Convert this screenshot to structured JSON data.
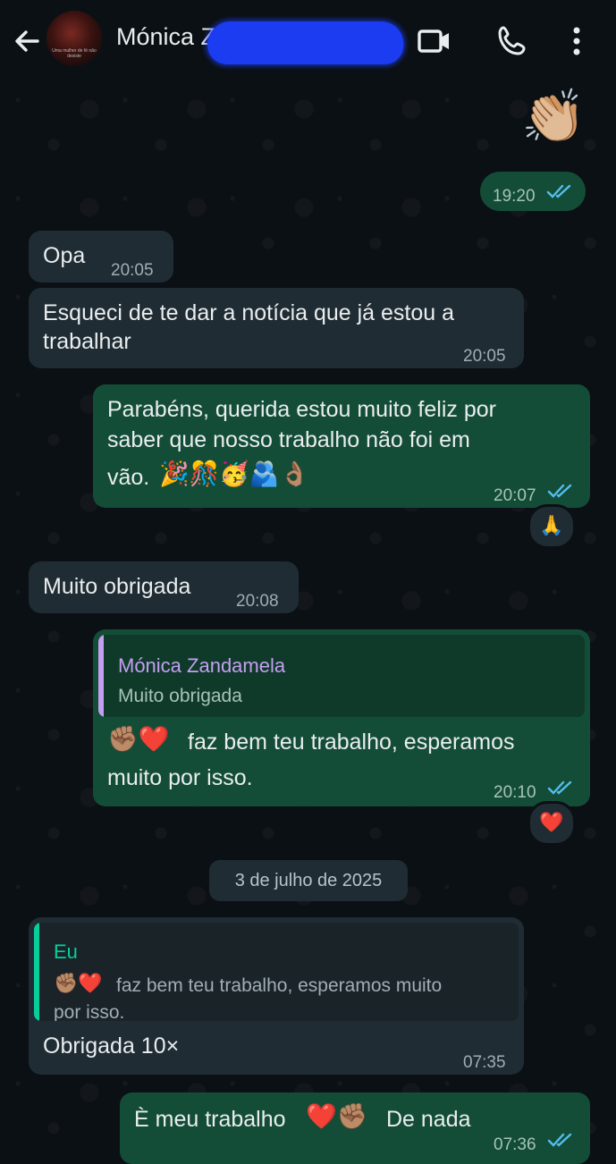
{
  "header": {
    "contact_name": "Mónica Z",
    "avatar_caption": "Uma mulher de fé não desiste"
  },
  "colors": {
    "incoming": "#1f2c33",
    "outgoing": "#144d37",
    "read_ticks": "#53bdeb",
    "reply_accent_other": "#c49ff0",
    "reply_accent_me": "#06cf9c"
  },
  "messages": [
    {
      "id": "m1",
      "sticker": "👏🏼",
      "time": "19:20",
      "status": "read"
    },
    {
      "id": "m2",
      "text": "Opa",
      "time": "20:05"
    },
    {
      "id": "m3",
      "line1": "Esqueci de te dar a notícia que já estou a",
      "line2": "trabalhar",
      "time": "20:05"
    },
    {
      "id": "m4",
      "line1": "Parabéns, querida estou muito feliz por",
      "line2": "saber que nosso trabalho não foi em",
      "line3": "vão.",
      "emojis": "🎉🎊🥳🫂👌🏽",
      "time": "20:07",
      "status": "read",
      "reaction": "🙏"
    },
    {
      "id": "m5",
      "text": "Muito obrigada",
      "time": "20:08"
    },
    {
      "id": "m6",
      "reply_author": "Mónica Zandamela",
      "reply_text": "Muito obrigada",
      "emojis": "✊🏽❤️",
      "line1": "faz bem teu trabalho, esperamos",
      "line2": "muito por isso.",
      "time": "20:10",
      "status": "read",
      "reaction": "❤️"
    },
    {
      "id": "m7",
      "reply_author": "Eu",
      "reply_emojis": "✊🏽❤️",
      "reply_line1": "faz bem teu trabalho, esperamos muito",
      "reply_line2": "por isso.",
      "text": "Obrigada 10×",
      "time": "07:35"
    },
    {
      "id": "m8",
      "text_a": "È meu trabalho",
      "emojis": "❤️✊🏽",
      "text_b": "De nada",
      "time": "07:36",
      "status": "read"
    }
  ],
  "date_separator": "3 de julho de 2025"
}
